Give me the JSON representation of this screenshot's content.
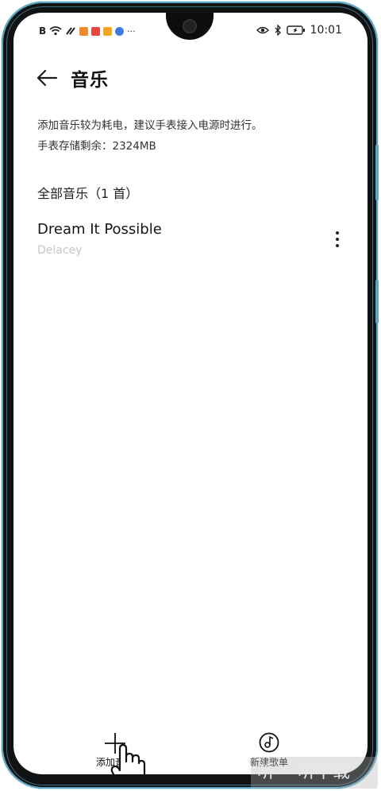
{
  "status_bar": {
    "time": "10:01",
    "left_icons": [
      "B",
      "wifi",
      "signal",
      "app-orange",
      "app-red",
      "app-amber",
      "app-blue"
    ],
    "more": "···",
    "accent_colors": [
      "#f08b2c",
      "#e8453c",
      "#f5a623",
      "#3d7be0"
    ]
  },
  "header": {
    "title": "音乐"
  },
  "info": {
    "line1": "添加音乐较为耗电，建议手表接入电源时进行。",
    "line2": "手表存储剩余：2324MB"
  },
  "section": {
    "title": "全部音乐（1 首）"
  },
  "songs": [
    {
      "title": "Dream It Possible",
      "artist": "Delacey"
    }
  ],
  "actions": {
    "add_label": "添加音乐",
    "new_playlist_label": "新建歌单"
  },
  "watermark": "听 一听下载"
}
